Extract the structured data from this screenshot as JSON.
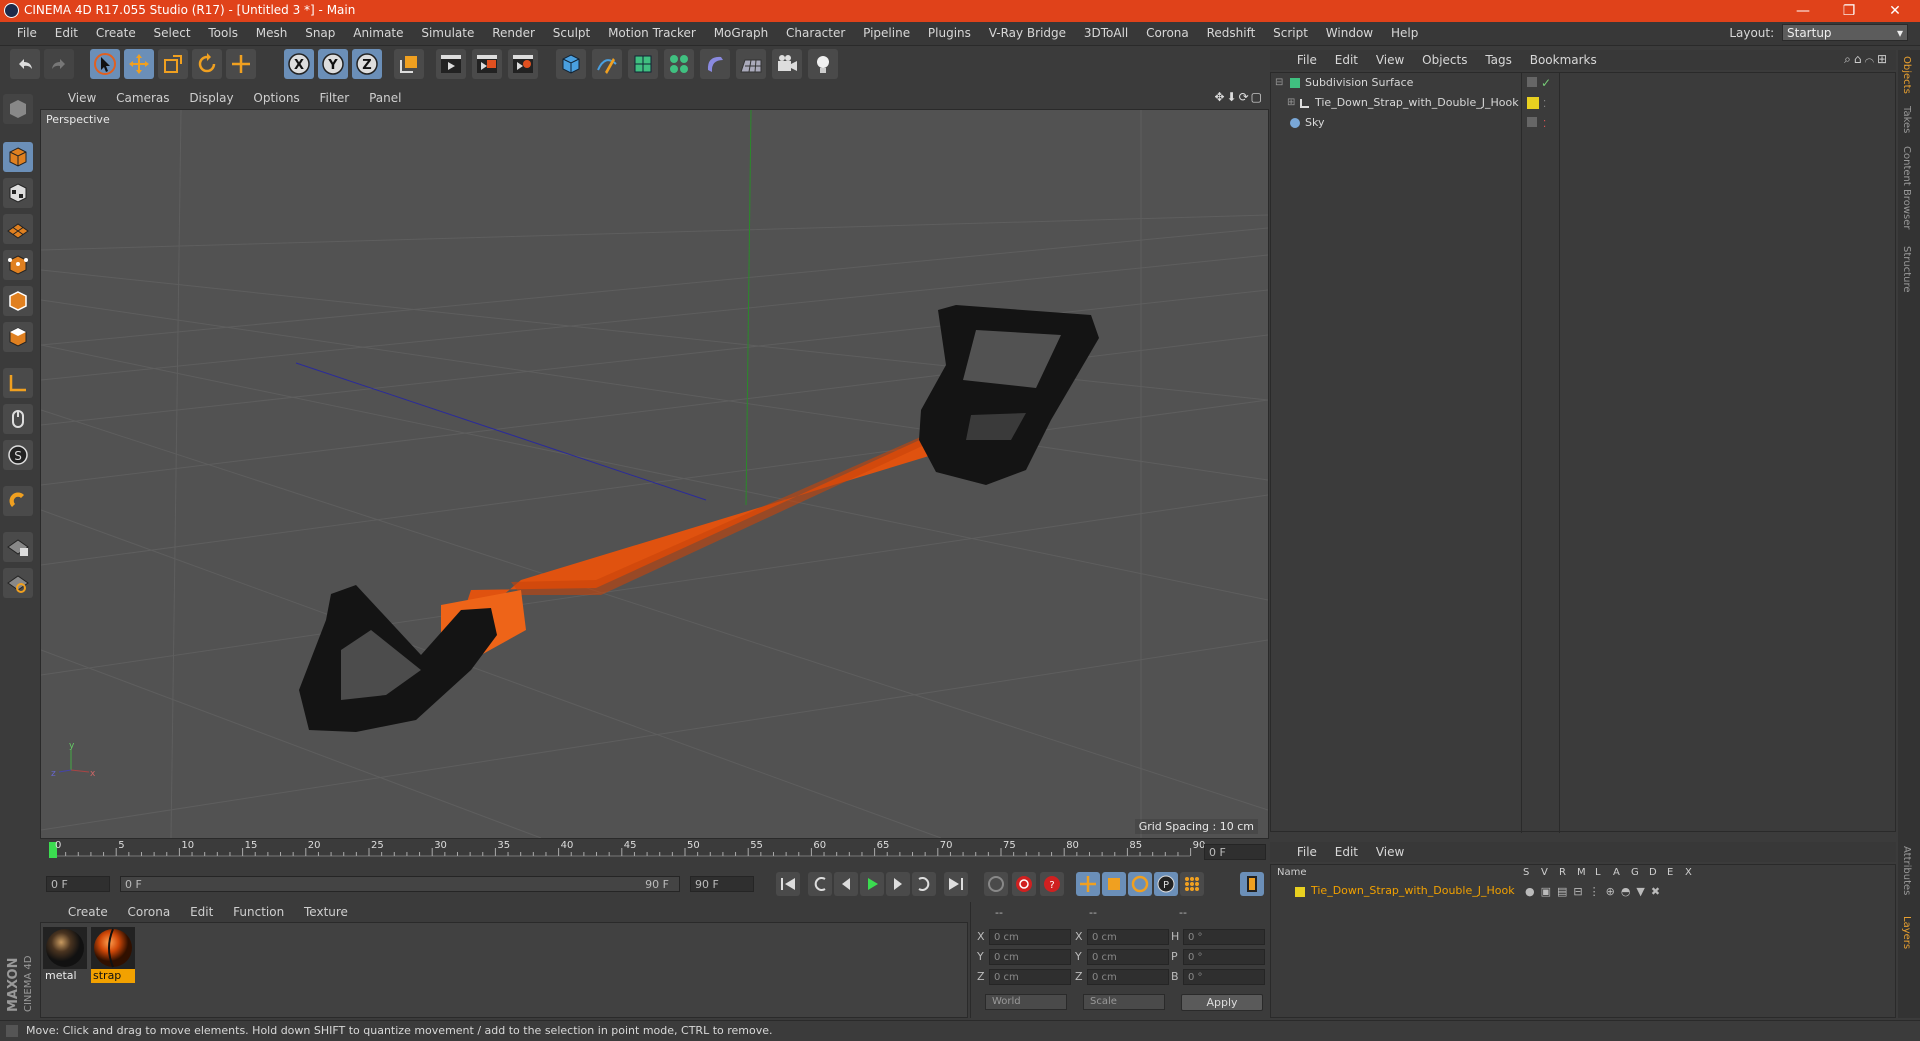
{
  "window": {
    "title": "CINEMA 4D R17.055 Studio (R17) - [Untitled 3 *] - Main",
    "controls": [
      "—",
      "❐",
      "✕"
    ]
  },
  "menubar": {
    "items": [
      "File",
      "Edit",
      "Create",
      "Select",
      "Tools",
      "Mesh",
      "Snap",
      "Animate",
      "Simulate",
      "Render",
      "Sculpt",
      "Motion Tracker",
      "MoGraph",
      "Character",
      "Pipeline",
      "Plugins",
      "V-Ray Bridge",
      "3DToAll",
      "Corona",
      "Redshift",
      "Script",
      "Window",
      "Help"
    ],
    "layout_label": "Layout:",
    "layout_value": "Startup"
  },
  "toolbar": {
    "icons": [
      "undo-icon",
      "redo-icon",
      "select-arrow-icon",
      "move-icon",
      "scale-icon",
      "rotate-icon",
      "live-selection-icon",
      "x-axis-icon",
      "y-axis-icon",
      "z-axis-icon",
      "coordinate-system-icon",
      "render-view-icon",
      "render-picture-viewer-icon",
      "render-settings-icon",
      "cube-icon",
      "pen-spline-icon",
      "subdivision-icon",
      "cloner-icon",
      "deformer-icon",
      "floor-icon",
      "camera-icon",
      "light-icon"
    ],
    "axis_labels": [
      "X",
      "Y",
      "Z"
    ]
  },
  "viewport": {
    "menu": [
      "View",
      "Cameras",
      "Display",
      "Options",
      "Filter",
      "Panel"
    ],
    "label": "Perspective",
    "grid_spacing": "Grid Spacing : 10 cm"
  },
  "timeline": {
    "ticks": [
      "0",
      "5",
      "10",
      "15",
      "20",
      "25",
      "30",
      "35",
      "40",
      "45",
      "50",
      "55",
      "60",
      "65",
      "70",
      "75",
      "80",
      "85",
      "90"
    ],
    "current_frame": "0 F",
    "start_field": "0 F",
    "range_start": "0 F",
    "range_end": "90 F",
    "end_field": "90 F"
  },
  "materials": {
    "menu": [
      "Create",
      "Corona",
      "Edit",
      "Function",
      "Texture"
    ],
    "items": [
      {
        "name": "metal",
        "selected": false
      },
      {
        "name": "strap",
        "selected": true
      }
    ]
  },
  "coordinates": {
    "headers": [
      "--",
      "--",
      "--"
    ],
    "rows": [
      {
        "a": "X",
        "av": "0 cm",
        "b": "X",
        "bv": "0 cm",
        "c": "H",
        "cv": "0 °"
      },
      {
        "a": "Y",
        "av": "0 cm",
        "b": "Y",
        "bv": "0 cm",
        "c": "P",
        "cv": "0 °"
      },
      {
        "a": "Z",
        "av": "0 cm",
        "b": "Z",
        "bv": "0 cm",
        "c": "B",
        "cv": "0 °"
      }
    ],
    "world": "World",
    "scale": "Scale",
    "apply": "Apply"
  },
  "object_manager": {
    "menu": [
      "File",
      "Edit",
      "View",
      "Objects",
      "Tags",
      "Bookmarks"
    ],
    "objects": [
      {
        "name": "Subdivision Surface",
        "icon": "subdivision-icon"
      },
      {
        "name": "Tie_Down_Strap_with_Double_J_Hook",
        "icon": "null-icon"
      },
      {
        "name": "Sky",
        "icon": "sky-icon"
      }
    ]
  },
  "layer_manager": {
    "menu": [
      "File",
      "Edit",
      "View"
    ],
    "headers": [
      "Name",
      "S",
      "V",
      "R",
      "M",
      "L",
      "A",
      "G",
      "D",
      "E",
      "X"
    ],
    "layers": [
      {
        "name": "Tie_Down_Strap_with_Double_J_Hook"
      }
    ]
  },
  "right_tabs": [
    "Objects",
    "Takes",
    "Content Browser",
    "Structure",
    "Attributes",
    "Layers"
  ],
  "status": "Move: Click and drag to move elements. Hold down SHIFT to quantize movement / add to the selection in point mode, CTRL to remove.",
  "logo": {
    "line1": "MAXON",
    "line2": "CINEMA 4D"
  },
  "colors": {
    "title_bar": "#e0421a",
    "strap": "#e0520f",
    "hook": "#141414",
    "selection_orange": "#f2a100",
    "layer_color": "#e8d020"
  }
}
